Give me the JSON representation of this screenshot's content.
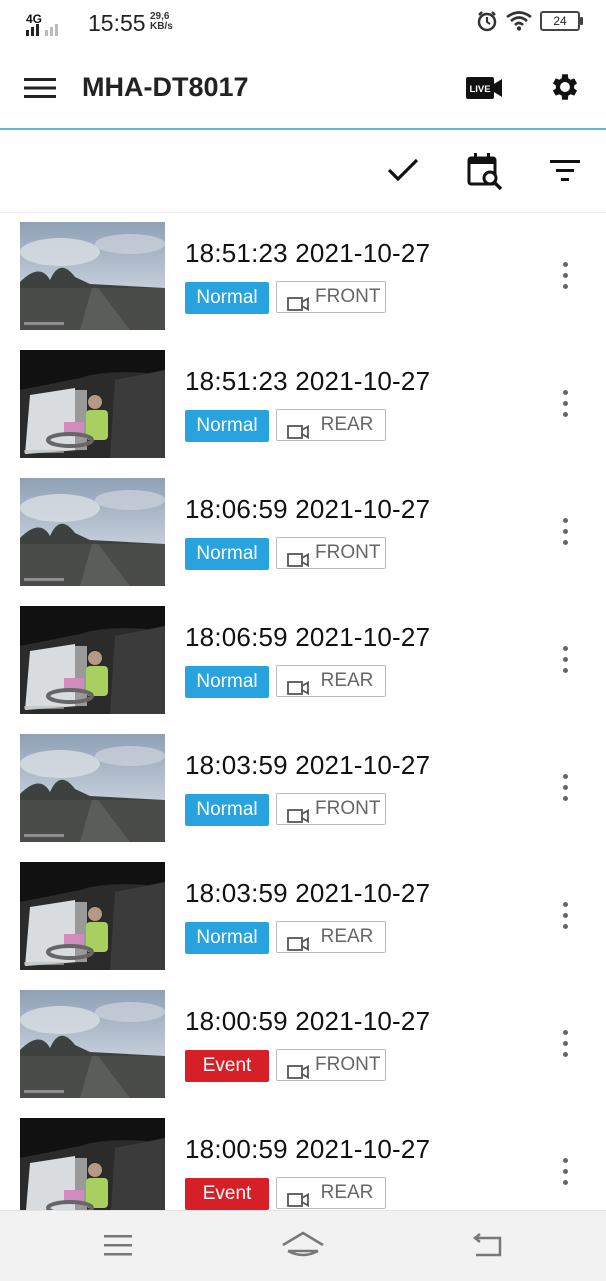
{
  "status_bar": {
    "network": "4G",
    "time": "15:55",
    "rate_value": "29,6",
    "rate_unit": "KB/s",
    "battery": "24"
  },
  "app_bar": {
    "title": "MHA-DT8017",
    "live_label": "LIVE"
  },
  "colors": {
    "accent_line": "#5fb6d9",
    "normal_badge": "#29a3e0",
    "event_badge": "#d71f27"
  },
  "recordings": [
    {
      "timestamp": "18:51:23  2021-10-27",
      "type": "Normal",
      "camera": "FRONT",
      "thumb": "road"
    },
    {
      "timestamp": "18:51:23  2021-10-27",
      "type": "Normal",
      "camera": "REAR",
      "thumb": "cabin"
    },
    {
      "timestamp": "18:06:59  2021-10-27",
      "type": "Normal",
      "camera": "FRONT",
      "thumb": "road"
    },
    {
      "timestamp": "18:06:59  2021-10-27",
      "type": "Normal",
      "camera": "REAR",
      "thumb": "cabin"
    },
    {
      "timestamp": "18:03:59  2021-10-27",
      "type": "Normal",
      "camera": "FRONT",
      "thumb": "road"
    },
    {
      "timestamp": "18:03:59  2021-10-27",
      "type": "Normal",
      "camera": "REAR",
      "thumb": "cabin"
    },
    {
      "timestamp": "18:00:59  2021-10-27",
      "type": "Event",
      "camera": "FRONT",
      "thumb": "road"
    },
    {
      "timestamp": "18:00:59  2021-10-27",
      "type": "Event",
      "camera": "REAR",
      "thumb": "cabin"
    }
  ]
}
